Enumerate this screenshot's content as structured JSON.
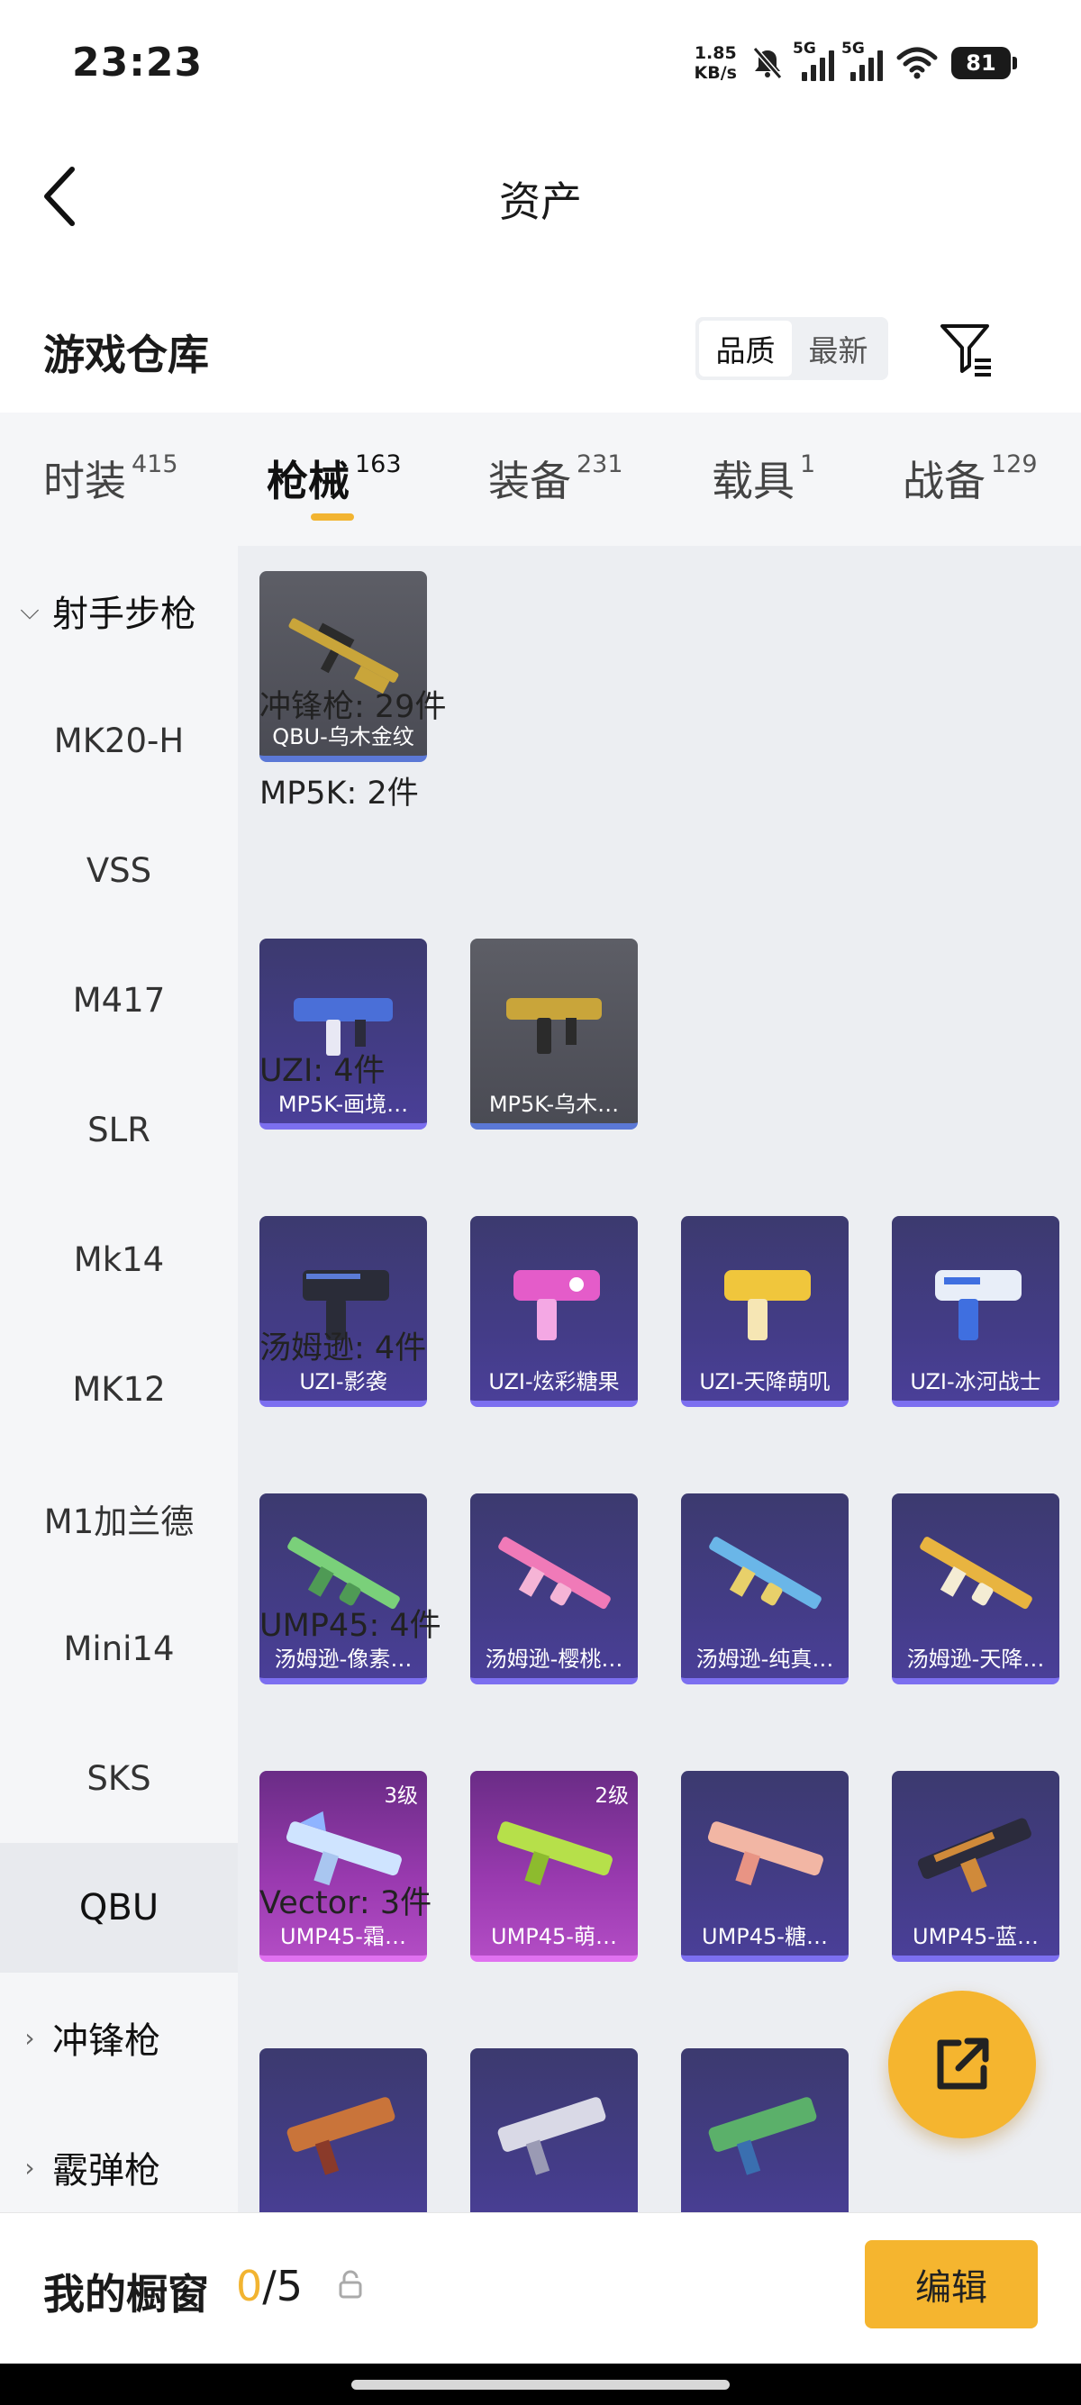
{
  "status_bar": {
    "time": "23:23",
    "net_speed_value": "1.85",
    "net_speed_unit": "KB/s",
    "sim1": "5G",
    "sim2": "5G",
    "battery": "81"
  },
  "header": {
    "title": "资产",
    "back_icon": "chevron-left-icon"
  },
  "section": {
    "title": "游戏仓库",
    "sort_options": [
      "品质",
      "最新"
    ],
    "sort_active": "品质",
    "filter_icon": "filter-list-icon"
  },
  "tabs": [
    {
      "label": "时装",
      "count": "415"
    },
    {
      "label": "枪械",
      "count": "163",
      "active": true
    },
    {
      "label": "装备",
      "count": "231"
    },
    {
      "label": "载具",
      "count": "1"
    },
    {
      "label": "战备",
      "count": "129"
    }
  ],
  "sidebar": {
    "group_open": "射手步枪",
    "items": [
      "MK20-H",
      "VSS",
      "M417",
      "SLR",
      "Mk14",
      "MK12",
      "M1加兰德",
      "Mini14",
      "SKS",
      "QBU"
    ],
    "active_item": "QBU",
    "groups_collapsed": [
      "冲锋枪",
      "霰弹枪"
    ]
  },
  "content": {
    "qbu_items": [
      {
        "name": "QBU-乌木金纹",
        "style": "gray"
      }
    ],
    "category_heading": "冲锋枪: 29件",
    "groups": [
      {
        "label": "MP5K: 2件",
        "items": [
          {
            "name": "MP5K-画境…",
            "style": "purple",
            "gun_color": "#4a6fd8"
          },
          {
            "name": "MP5K-乌木…",
            "style": "gray",
            "gun_color": "#c9a53a"
          }
        ]
      },
      {
        "label": "UZI: 4件",
        "items": [
          {
            "name": "UZI-影袭",
            "style": "purple",
            "gun_color": "#2a2c38"
          },
          {
            "name": "UZI-炫彩糖果",
            "style": "purple",
            "gun_color": "#e45cc9"
          },
          {
            "name": "UZI-天降萌叽",
            "style": "purple",
            "gun_color": "#f0c63c"
          },
          {
            "name": "UZI-冰河战士",
            "style": "purple",
            "gun_color": "#3f6fe0"
          }
        ]
      },
      {
        "label": "汤姆逊: 4件",
        "items": [
          {
            "name": "汤姆逊-像素…",
            "style": "purple",
            "gun_color": "#7ad07a"
          },
          {
            "name": "汤姆逊-樱桃…",
            "style": "purple",
            "gun_color": "#f07ab8"
          },
          {
            "name": "汤姆逊-纯真…",
            "style": "purple",
            "gun_color": "#6ab6e8"
          },
          {
            "name": "汤姆逊-天降…",
            "style": "purple",
            "gun_color": "#e8b440"
          }
        ]
      },
      {
        "label": "UMP45: 4件",
        "items": [
          {
            "name": "UMP45-霜…",
            "style": "pink",
            "level": "3级",
            "gun_color": "#cfe4ff"
          },
          {
            "name": "UMP45-萌…",
            "style": "pink",
            "level": "2级",
            "gun_color": "#b6e04a"
          },
          {
            "name": "UMP45-糖…",
            "style": "purple",
            "gun_color": "#f2b6a4"
          },
          {
            "name": "UMP45-蓝…",
            "style": "purple",
            "gun_color": "#d08a3a"
          }
        ]
      },
      {
        "label": "Vector: 3件",
        "items": [
          {
            "name": "",
            "style": "purple",
            "gun_color": "#c9743a"
          },
          {
            "name": "",
            "style": "purple",
            "gun_color": "#d9d9e6"
          },
          {
            "name": "",
            "style": "purple",
            "gun_color": "#5bb06a"
          }
        ]
      }
    ]
  },
  "fab": {
    "icon": "share-external-icon"
  },
  "bottom": {
    "label": "我的橱窗",
    "count_current": "0",
    "count_total": "/5",
    "lock_icon": "lock-icon",
    "edit_label": "编辑"
  },
  "colors": {
    "accent": "#f5b52f",
    "rare_purple": "#433c86",
    "epic_pink": "#9a3ab0",
    "base_gray": "#55565e"
  }
}
